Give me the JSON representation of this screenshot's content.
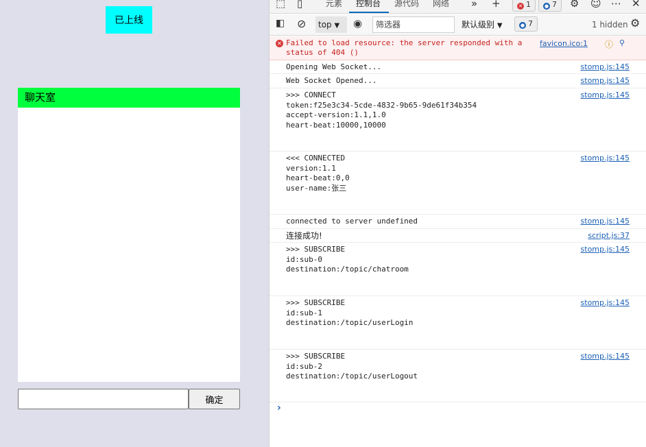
{
  "page": {
    "status_text": "已上线",
    "chat_title": "聊天室",
    "input_value": "",
    "confirm_label": "确定"
  },
  "devtools": {
    "tabs": [
      "元素",
      "控制台",
      "源代码",
      "网络"
    ],
    "active_tab": "控制台",
    "error_count": "1",
    "message_count": "7",
    "context": "top",
    "filter_placeholder": "筛选器",
    "level": "默认级别",
    "level_badge_count": "7",
    "hidden_text": "1 hidden",
    "error": {
      "text": "Failed to load resource: the server responded with a status of 404 ()",
      "source": "favicon.ico:1"
    },
    "logs": [
      {
        "text": "Opening Web Socket...",
        "source": "stomp.js:145"
      },
      {
        "text": "Web Socket Opened...",
        "source": "stomp.js:145"
      },
      {
        "text": ">>> CONNECT\ntoken:f25e3c34-5cde-4832-9b65-9de61f34b354\naccept-version:1.1,1.0\nheart-beat:10000,10000",
        "source": "stomp.js:145"
      },
      {
        "text": "<<< CONNECTED\nversion:1.1\nheart-beat:0,0\nuser-name:张三",
        "source": "stomp.js:145"
      },
      {
        "text": "connected to server undefined",
        "source": "stomp.js:145"
      },
      {
        "text": "连接成功!",
        "source": "script.js:37"
      },
      {
        "text": ">>> SUBSCRIBE\nid:sub-0\ndestination:/topic/chatroom",
        "source": "stomp.js:145"
      },
      {
        "text": ">>> SUBSCRIBE\nid:sub-1\ndestination:/topic/userLogin",
        "source": "stomp.js:145"
      },
      {
        "text": ">>> SUBSCRIBE\nid:sub-2\ndestination:/topic/userLogout",
        "source": "stomp.js:145"
      }
    ]
  },
  "colors": {
    "page_bg": "#dfdfeb",
    "status_bg": "#00ffff",
    "chat_header_bg": "#00ff3c",
    "error_bg": "#fdf1f1",
    "link": "#1a5fb4"
  }
}
